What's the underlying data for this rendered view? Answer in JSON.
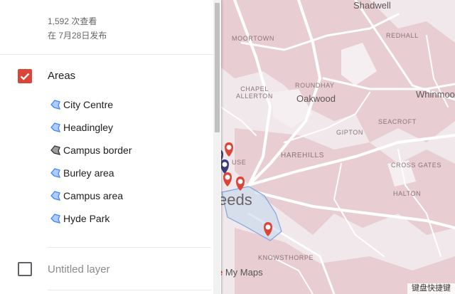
{
  "map": {
    "labels": {
      "shadwell": "Shadwell",
      "moortown": "MOORTOWN",
      "redhall": "REDHALL",
      "chapel_allerton": "CHAPEL ALLERTON",
      "roundhay": "ROUNDHAY",
      "oakwood": "Oakwood",
      "whinmoor": "Whinmoor",
      "gipton": "GIPTON",
      "seacroft": "SEACROFT",
      "harehills": "HAREHILLS",
      "cross_gates": "CROSS GATES",
      "halton": "HALTON",
      "leeds": "eeds",
      "knowsthorpe": "KNOWSTHORPE",
      "house": "USE"
    },
    "brand_suffix": "e My Maps",
    "keyboard_shortcuts": "键盘快捷键",
    "colors": {
      "land": "#f0e8ea",
      "urban": "#e8cdd2",
      "road": "#ffffff",
      "water": "#bcd4ec",
      "pin": "#db4437",
      "pin_dark": "#3c3a78"
    }
  },
  "panel": {
    "views": "1,592 次查看",
    "published": "在 7月28日发布",
    "layers": [
      {
        "title": "Areas",
        "checked": true,
        "title_color": "#212121",
        "items": [
          {
            "label": "City Centre",
            "icon": "polygon-blue-icon",
            "color": "#4285f4"
          },
          {
            "label": "Headingley",
            "icon": "polygon-blue-icon",
            "color": "#4285f4"
          },
          {
            "label": "Campus border",
            "icon": "polygon-dark-icon",
            "color": "#444444"
          },
          {
            "label": "Burley area",
            "icon": "polygon-blue-icon",
            "color": "#4285f4"
          },
          {
            "label": "Campus area",
            "icon": "polygon-blue-icon",
            "color": "#4285f4"
          },
          {
            "label": "Hyde Park",
            "icon": "polygon-blue-icon",
            "color": "#4285f4"
          }
        ]
      },
      {
        "title": "Untitled layer",
        "checked": false,
        "title_color": "#8a8a8a",
        "items": []
      }
    ]
  }
}
